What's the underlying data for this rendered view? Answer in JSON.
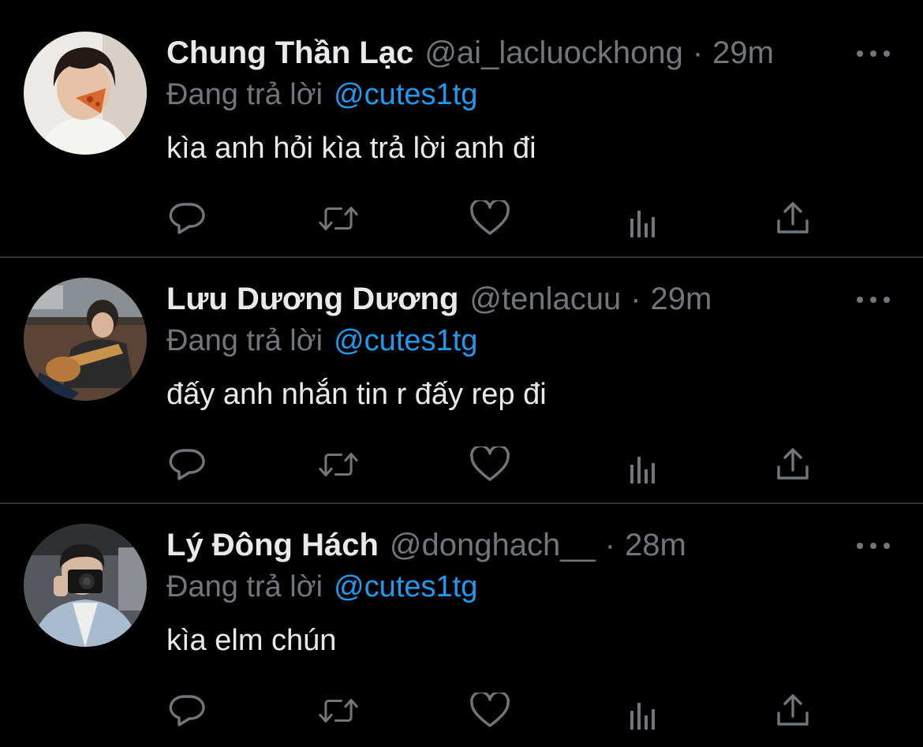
{
  "colors": {
    "background": "#000000",
    "divider": "#2f3336",
    "primary_text": "#e7e9ea",
    "secondary_text": "#71767b",
    "link": "#1d9bf0"
  },
  "more_icon": "more-horizontal-icon",
  "actions": [
    {
      "name": "reply",
      "icon": "reply-bubble-icon"
    },
    {
      "name": "retweet",
      "icon": "retweet-icon"
    },
    {
      "name": "like",
      "icon": "heart-icon"
    },
    {
      "name": "analytics",
      "icon": "bar-chart-icon"
    },
    {
      "name": "share",
      "icon": "share-upload-icon"
    }
  ],
  "tweets": [
    {
      "name": "Chung Thần Lạc",
      "handle": "@ai_lacluockhong",
      "separator": "·",
      "time": "29m",
      "replying_label": "Đang trả lời",
      "replying_to": "@cutes1tg",
      "text": "kìa anh hỏi kìa trả lời anh đi"
    },
    {
      "name": "Lưu Dương Dương",
      "handle": "@tenlacuu",
      "separator": "·",
      "time": "29m",
      "replying_label": "Đang trả lời",
      "replying_to": "@cutes1tg",
      "text": "đấy anh nhắn tin r đấy rep đi"
    },
    {
      "name": "Lý Đông Hách",
      "handle": "@donghach__",
      "separator": "·",
      "time": "28m",
      "replying_label": "Đang trả lời",
      "replying_to": "@cutes1tg",
      "text": "kìa elm chún"
    }
  ]
}
